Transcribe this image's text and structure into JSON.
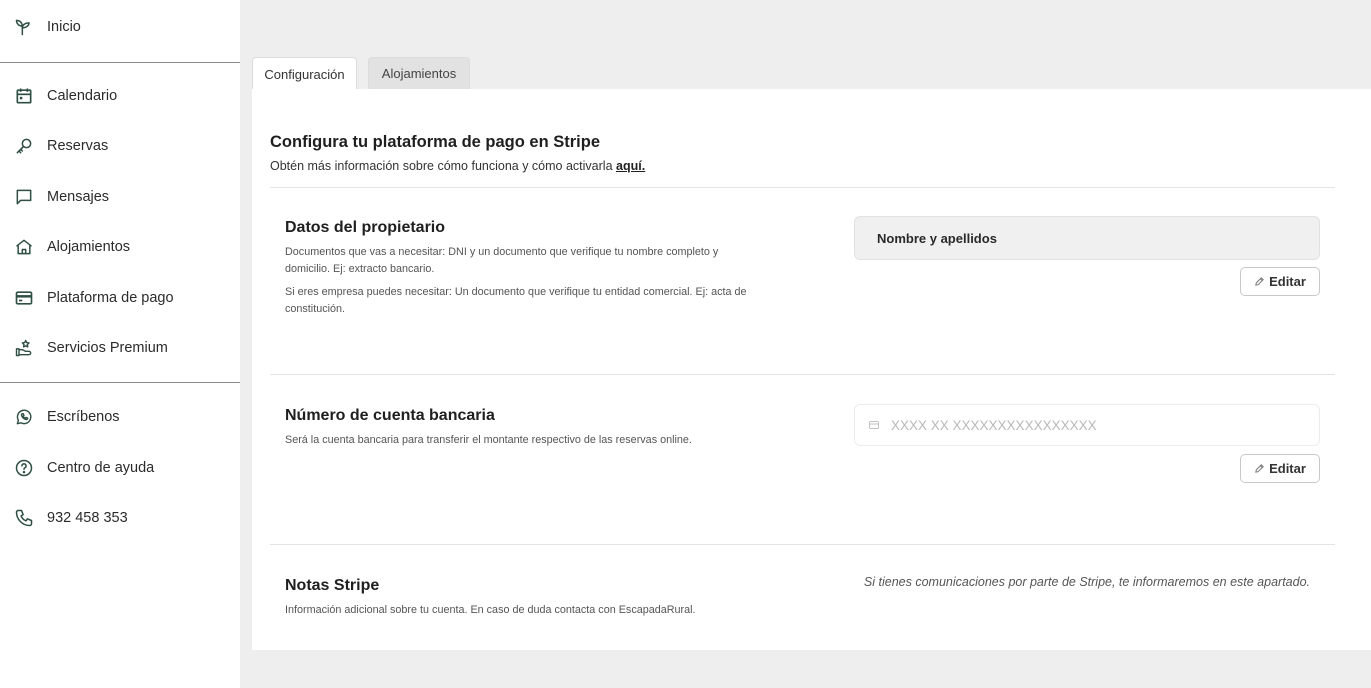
{
  "sidebar": {
    "items": [
      {
        "label": "Inicio",
        "icon": "sprout-icon"
      },
      {
        "label": "Calendario",
        "icon": "calendar-icon"
      },
      {
        "label": "Reservas",
        "icon": "key-icon"
      },
      {
        "label": "Mensajes",
        "icon": "message-icon"
      },
      {
        "label": "Alojamientos",
        "icon": "house-icon"
      },
      {
        "label": "Plataforma de pago",
        "icon": "credit-card-icon"
      },
      {
        "label": "Servicios Premium",
        "icon": "hand-star-icon"
      },
      {
        "label": "Escríbenos",
        "icon": "whatsapp-icon"
      },
      {
        "label": "Centro de ayuda",
        "icon": "help-circle-icon"
      },
      {
        "label": "932 458 353",
        "icon": "phone-icon"
      }
    ]
  },
  "tabs": [
    {
      "label": "Configuración",
      "active": true
    },
    {
      "label": "Alojamientos",
      "active": false
    }
  ],
  "main": {
    "title": "Configura tu plataforma de pago en Stripe",
    "subtitle": "Obtén más información sobre cómo funciona y cómo activarla ",
    "subtitle_link": "aquí."
  },
  "owner": {
    "title": "Datos del propietario",
    "desc1": "Documentos que vas a necesitar: DNI y un documento que verifique tu nombre completo y domicilio. Ej: extracto bancario.",
    "desc2": "Si eres empresa puedes necesitar: Un documento que verifique tu entidad comercial. Ej: acta de constitución.",
    "field_value": "Nombre y apellidos",
    "edit_label": "Editar"
  },
  "bank": {
    "title": "Número de cuenta bancaria",
    "desc": "Será la cuenta bancaria para transferir el montante respectivo de las reservas online.",
    "placeholder": "XXXX XX XXXXXXXXXXXXXXXX",
    "edit_label": "Editar"
  },
  "notes": {
    "title": "Notas Stripe",
    "desc": "Información adicional sobre tu cuenta. En caso de duda contacta con EscapadaRural.",
    "info": "Si tienes comunicaciones por parte de Stripe, te informaremos en este apartado."
  },
  "colors": {
    "icon": "#2f4f45",
    "background": "#eeeeee",
    "panel": "#ffffff"
  }
}
